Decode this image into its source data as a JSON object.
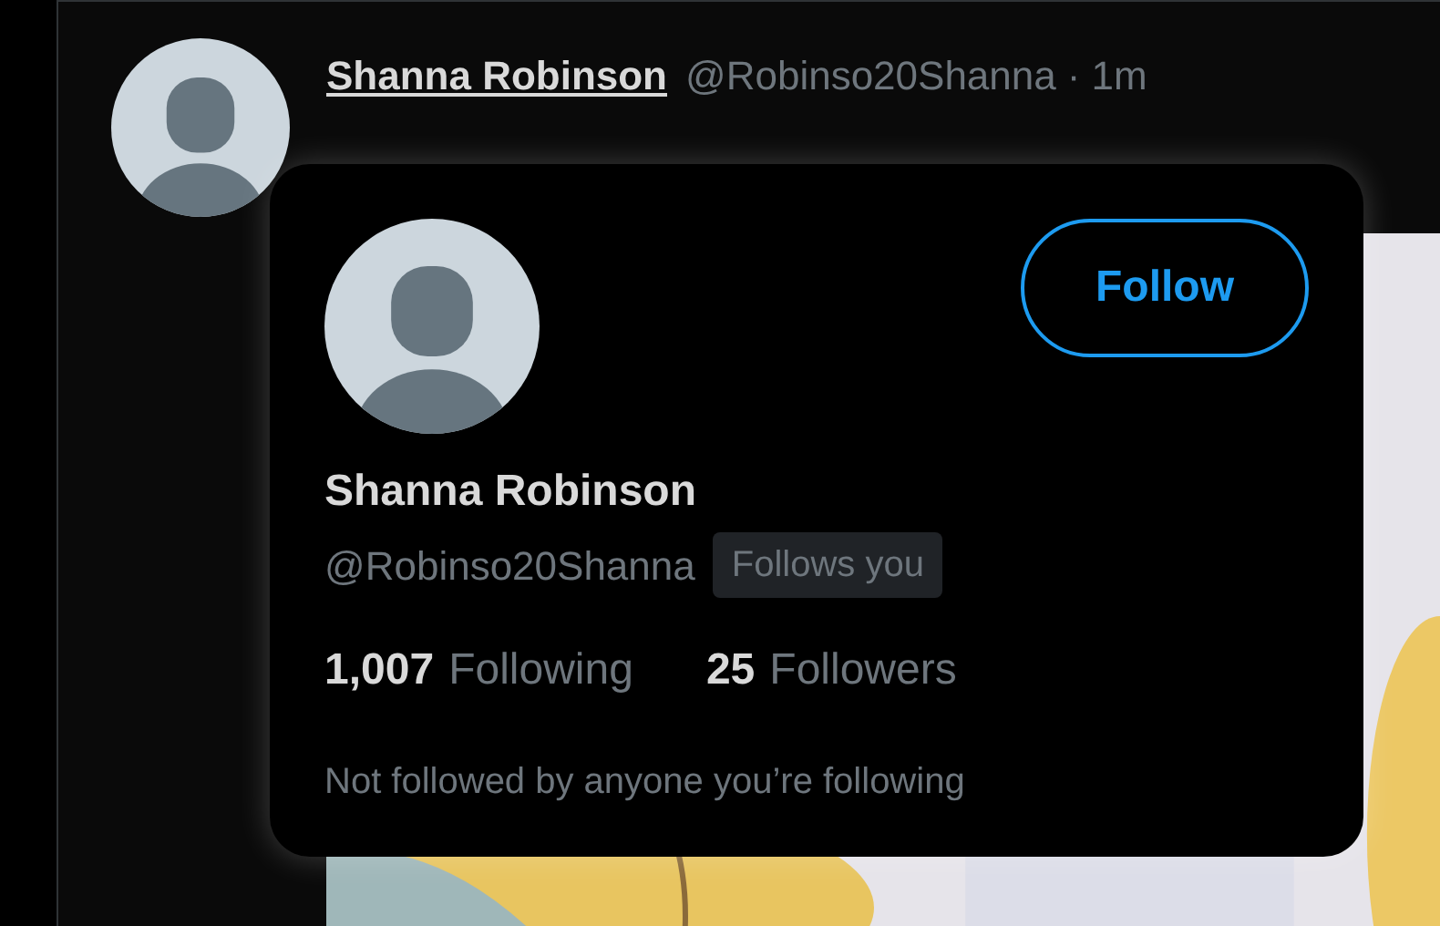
{
  "tweet": {
    "name": "Shanna Robinson",
    "handle": "@Robinso20Shanna",
    "separator": "·",
    "time": "1m"
  },
  "hover_card": {
    "follow_button": "Follow",
    "name": "Shanna Robinson",
    "handle": "@Robinso20Shanna",
    "follows_you_badge": "Follows you",
    "stats": [
      {
        "count": "1,007",
        "label": "Following"
      },
      {
        "count": "25",
        "label": "Followers"
      }
    ],
    "note": "Not followed by anyone you’re following"
  }
}
